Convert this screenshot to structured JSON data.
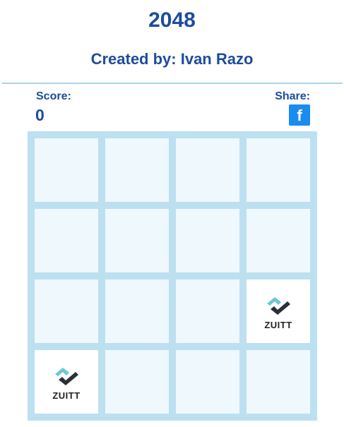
{
  "header": {
    "title": "2048",
    "subtitle": "Created by: Ivan Razo"
  },
  "score": {
    "label": "Score:",
    "value": "0"
  },
  "share": {
    "label": "Share:",
    "facebook_glyph": "f",
    "facebook_icon": "facebook-icon",
    "facebook_color": "#1a8cf0"
  },
  "board": {
    "rows": 4,
    "cols": 4,
    "tiles": [
      {
        "row": 2,
        "col": 3,
        "label": "ZUITT",
        "icon": "zuitt-logo-icon"
      },
      {
        "row": 3,
        "col": 0,
        "label": "ZUITT",
        "icon": "zuitt-logo-icon"
      }
    ]
  },
  "colors": {
    "heading": "#1d4c9e",
    "board_bg": "#bde0f0",
    "empty_cell": "#eef8fd",
    "tile_bg": "#ffffff",
    "logo_teal": "#6cc7d8",
    "logo_dark": "#2b2f3a"
  }
}
